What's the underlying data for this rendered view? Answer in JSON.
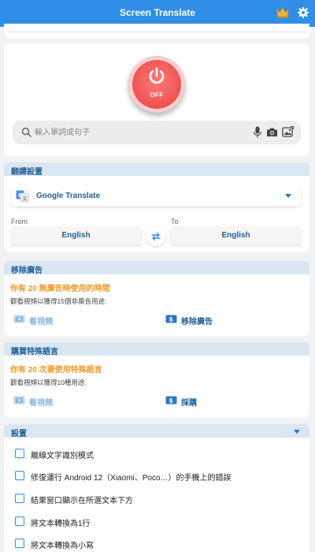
{
  "app": {
    "title": "Screen Translate"
  },
  "power": {
    "state_label": "OFF"
  },
  "search": {
    "placeholder": "輸入單詞或句子",
    "value": ""
  },
  "translation": {
    "section_title": "翻譯設置",
    "engine_label": "Google Translate",
    "from_caption": "From",
    "to_caption": "To",
    "from_lang": "English",
    "to_lang": "English"
  },
  "ads": {
    "section_title": "移除廣告",
    "headline": "你有 20 無廣告時使用的時間",
    "description": "觀看視頻以獲得15個非廣告用途:",
    "watch_label": "看視頻",
    "remove_label": "移除廣告"
  },
  "special_lang": {
    "section_title": "購買特殊語言",
    "headline": "你有 20 次要使用特殊語言",
    "description": "觀看視頻以獲得10種用途:",
    "watch_label": "看視頻",
    "buy_label": "採購"
  },
  "settings": {
    "section_title": "設置",
    "items": [
      {
        "label": "離線文字識別模式",
        "checked": false
      },
      {
        "label": "修復運行 Android 12（Xiaomi、Poco…）的手機上的錯誤",
        "checked": false
      },
      {
        "label": "結果窗口顯示在所選文本下方",
        "checked": false
      },
      {
        "label": "將文本轉換為1行",
        "checked": false
      },
      {
        "label": "將文本轉換為小寫",
        "checked": false
      }
    ]
  },
  "colors": {
    "app_bar": "#2f8fe6",
    "power_button": "#f25555",
    "section_header": "#dae6f2",
    "accent_text": "#1f5f96",
    "highlight": "#f09a24"
  }
}
